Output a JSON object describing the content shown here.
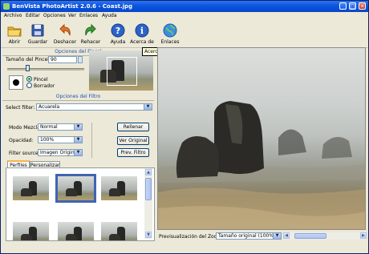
{
  "window": {
    "title": "BenVista PhotoArtist 2.0.6 - Coast.jpg"
  },
  "menu": [
    "Archivo",
    "Editar",
    "Opciones",
    "Ver",
    "Enlaces",
    "Ayuda"
  ],
  "toolbar": [
    {
      "label": "Abrir",
      "icon": "folder-icon"
    },
    {
      "label": "Guardar",
      "icon": "save-icon"
    },
    {
      "label": "Deshacer",
      "icon": "undo-icon"
    },
    {
      "label": "Rehacer",
      "icon": "redo-icon"
    },
    {
      "label": "Ayuda",
      "icon": "help-icon"
    },
    {
      "label": "Acerca de",
      "icon": "info-icon"
    },
    {
      "label": "Enlaces",
      "icon": "globe-icon"
    }
  ],
  "tooltip": "Acerca de PhotoArtist 2",
  "brush": {
    "header": "Opciones del Pincel",
    "size_label": "Tamaño del Pincel:",
    "size_value": "90",
    "mode_brush": "Pincel",
    "mode_eraser": "Borrador"
  },
  "filter": {
    "header": "Opciones del Filtro",
    "select_label": "Select filter:",
    "select_value": "Acuarela",
    "blend_label": "Modo Mezcla:",
    "blend_value": "Normal",
    "opacity_label": "Opacidad:",
    "opacity_value": "100%",
    "source_label": "Filter source:",
    "source_value": "Imagen Original",
    "fill_button": "Rellenar",
    "view_original_button": "Ver Original",
    "prev_filter_button": "Prev. Filtro"
  },
  "tabs": [
    "Perfiles",
    "Personalizar"
  ],
  "zoom": {
    "label": "Previsualización del Zoom:",
    "value": "Tamaño original (100%)"
  },
  "colors": {
    "titlebar": "#0a55e0",
    "selection": "#3f64b2",
    "link_blue": "#2350b0"
  }
}
